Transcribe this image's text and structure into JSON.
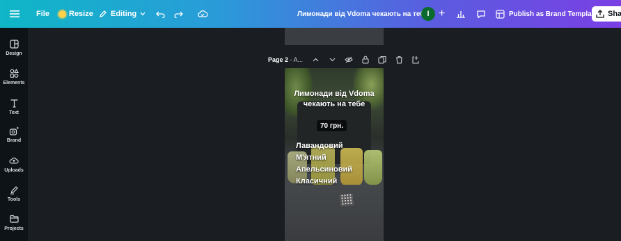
{
  "topbar": {
    "menu_icon": "hamburger-icon",
    "file_label": "File",
    "resize_label": "Resize",
    "editing_label": "Editing",
    "document_title": "Лимонади від Vdoma чекають на тебе",
    "avatar_initial": "I",
    "publish_label": "Publish as Brand Template",
    "share_label": "Shar"
  },
  "sidebar": {
    "items": [
      {
        "label": "Design",
        "icon": "layout-icon"
      },
      {
        "label": "Elements",
        "icon": "shapes-icon"
      },
      {
        "label": "Text",
        "icon": "text-icon"
      },
      {
        "label": "Brand",
        "icon": "brand-icon"
      },
      {
        "label": "Uploads",
        "icon": "upload-cloud-icon"
      },
      {
        "label": "Tools",
        "icon": "pen-icon"
      },
      {
        "label": "Projects",
        "icon": "folder-icon"
      }
    ]
  },
  "page_toolbar": {
    "page_label": "Page 2",
    "page_suffix": " - A..."
  },
  "design": {
    "headline_line1": "Лимонади від Vdoma",
    "headline_line2": "чекають на тебе",
    "price": "70 грн.",
    "flavors": [
      "Лавандовий",
      "М'ятний",
      "Апельсиновий",
      "Класичний"
    ]
  },
  "colors": {
    "gradient_start": "#0fb7c7",
    "gradient_end": "#7a3fe4",
    "background": "#1a1d21",
    "avatar": "#0b6b2e"
  }
}
